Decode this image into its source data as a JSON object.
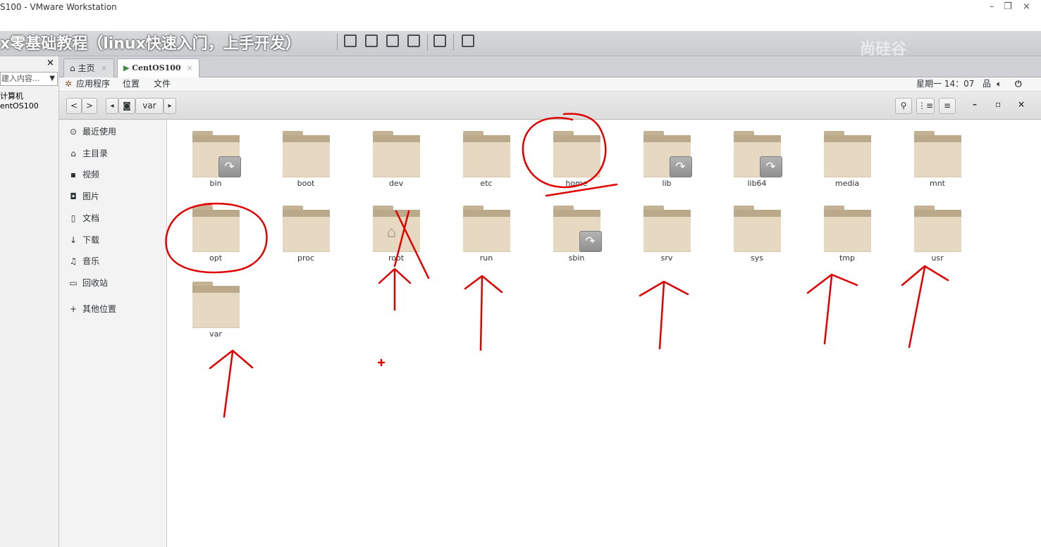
{
  "vmware": {
    "window_title": "S100 - VMware Workstation",
    "course_title": "x零基础教程（linux快速入门，上手开发）",
    "watermark": "尚硅谷",
    "window_controls": [
      "–",
      "❐",
      "×"
    ]
  },
  "library": {
    "close": "×",
    "search_placeholder": "建入内容...",
    "tree": [
      "计算机",
      "entOS100"
    ]
  },
  "vm_tabs": [
    {
      "label": "主页",
      "icon": "home-icon",
      "close": "×"
    },
    {
      "label": "CentOS100",
      "icon": "vm-icon",
      "close": "×"
    }
  ],
  "gnome": {
    "applications": "应用程序",
    "places": "位置",
    "files": "文件",
    "clock": "星期一 14：07",
    "tray_icons": [
      "network-icon",
      "volume-icon",
      "power-icon"
    ]
  },
  "nautilus": {
    "back": "<",
    "forward": ">",
    "path_left": "◂",
    "path_root_icon": "disk-icon",
    "path_current": "var",
    "path_right": "▸",
    "actions": [
      "search-icon",
      "view-list-icon",
      "menu-icon"
    ],
    "window_buttons": [
      "–",
      "▫",
      "×"
    ]
  },
  "sidebar": [
    {
      "label": "最近使用",
      "icon": "⊙"
    },
    {
      "label": "主目录",
      "icon": "⌂"
    },
    {
      "label": "视频",
      "icon": "▪"
    },
    {
      "label": "图片",
      "icon": "◘"
    },
    {
      "label": "文档",
      "icon": "▯"
    },
    {
      "label": "下载",
      "icon": "↓"
    },
    {
      "label": "音乐",
      "icon": "♫"
    },
    {
      "label": "回收站",
      "icon": "▭"
    },
    {
      "label": "其他位置",
      "icon": "+"
    }
  ],
  "folders": [
    {
      "name": "bin",
      "link": true
    },
    {
      "name": "boot",
      "link": false
    },
    {
      "name": "dev",
      "link": false
    },
    {
      "name": "etc",
      "link": false
    },
    {
      "name": "home",
      "link": false
    },
    {
      "name": "lib",
      "link": true
    },
    {
      "name": "lib64",
      "link": true
    },
    {
      "name": "media",
      "link": false
    },
    {
      "name": "mnt",
      "link": false
    },
    {
      "name": "opt",
      "link": false
    },
    {
      "name": "proc",
      "link": false
    },
    {
      "name": "root",
      "link": false,
      "home_emblem": true
    },
    {
      "name": "run",
      "link": false
    },
    {
      "name": "sbin",
      "link": true
    },
    {
      "name": "srv",
      "link": false
    },
    {
      "name": "sys",
      "link": false
    },
    {
      "name": "tmp",
      "link": false
    },
    {
      "name": "usr",
      "link": false
    },
    {
      "name": "var",
      "link": false
    }
  ],
  "colors": {
    "annotation": "#e00000",
    "folder_front": "#e7d9c1",
    "folder_back": "#bba98b"
  }
}
